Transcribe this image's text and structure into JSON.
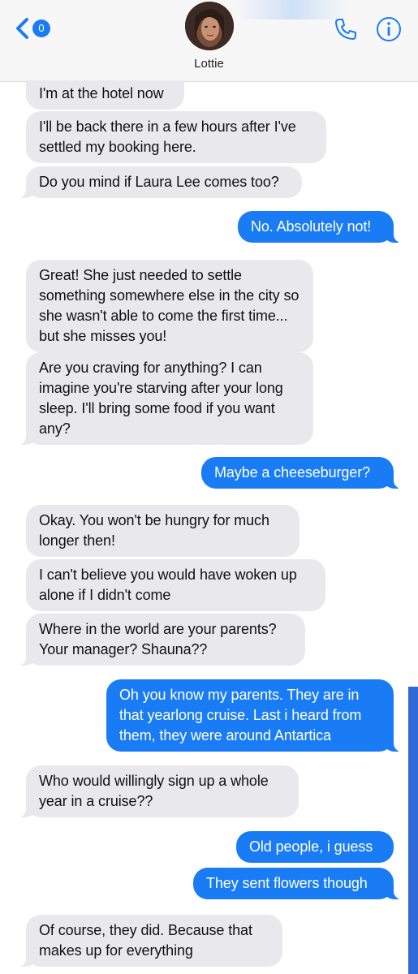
{
  "header": {
    "unread_count": "0",
    "contact_name": "Lottie",
    "icons": {
      "back": "chevron-left-icon",
      "call": "phone-icon",
      "info": "info-icon"
    },
    "accent_color": "#1a7cf5"
  },
  "messages": [
    {
      "dir": "in",
      "text": "I'm at the hotel now"
    },
    {
      "dir": "in",
      "text": "I'll be back there in a few hours after I've settled my booking here."
    },
    {
      "dir": "in",
      "text": "Do you mind if Laura Lee comes too?"
    },
    {
      "dir": "out",
      "text": "No. Absolutely not!"
    },
    {
      "dir": "in",
      "text": "Great! She just needed to settle something somewhere else in the city so she wasn't able to come the first time... but she misses you!"
    },
    {
      "dir": "in",
      "text": "Are you craving for anything? I can imagine you're starving after your long sleep. I'll bring some food if you want any?"
    },
    {
      "dir": "out",
      "text": "Maybe a cheeseburger?"
    },
    {
      "dir": "in",
      "text": "Okay. You won't be hungry for much longer then!"
    },
    {
      "dir": "in",
      "text": "I can't believe you would have woken up alone if I didn't come"
    },
    {
      "dir": "in",
      "text": "Where in the world are your parents? Your manager? Shauna??"
    },
    {
      "dir": "out",
      "text": "Oh you know my parents. They are in that yearlong cruise. Last i heard from them, they were around Antartica"
    },
    {
      "dir": "in",
      "text": "Who would willingly sign up a whole year in a cruise??"
    },
    {
      "dir": "out",
      "text": "Old people, i guess"
    },
    {
      "dir": "out",
      "text": "They sent flowers though"
    },
    {
      "dir": "in",
      "text": "Of course, they did. Because that makes up for everything"
    }
  ]
}
